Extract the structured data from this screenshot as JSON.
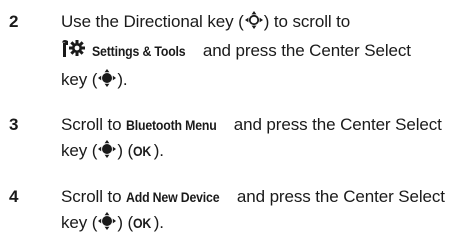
{
  "steps": [
    {
      "number": "2",
      "line1_pre": "Use the Directional key (",
      "line1_post": ") to scroll to",
      "menu_label": "Settings & Tools",
      "line2_post": " and press the Center Select",
      "line3_pre": "key (",
      "line3_post": ")."
    },
    {
      "number": "3",
      "pre": "Scroll to ",
      "menu_label": "Bluetooth Menu",
      "post": " and press the Center Select",
      "line2_pre": "key (",
      "line2_mid": ") (",
      "ok_label": "OK",
      "line2_post": ")."
    },
    {
      "number": "4",
      "pre": "Scroll to ",
      "menu_label": "Add New Device",
      "post": " and press the Center Select",
      "line2_pre": "key (",
      "line2_mid": ") (",
      "ok_label": "OK",
      "line2_post": ")."
    }
  ],
  "icons": {
    "directional_key": "directional-key-icon",
    "center_select_key": "center-select-key-icon",
    "settings_tools": "settings-tools-icon"
  }
}
